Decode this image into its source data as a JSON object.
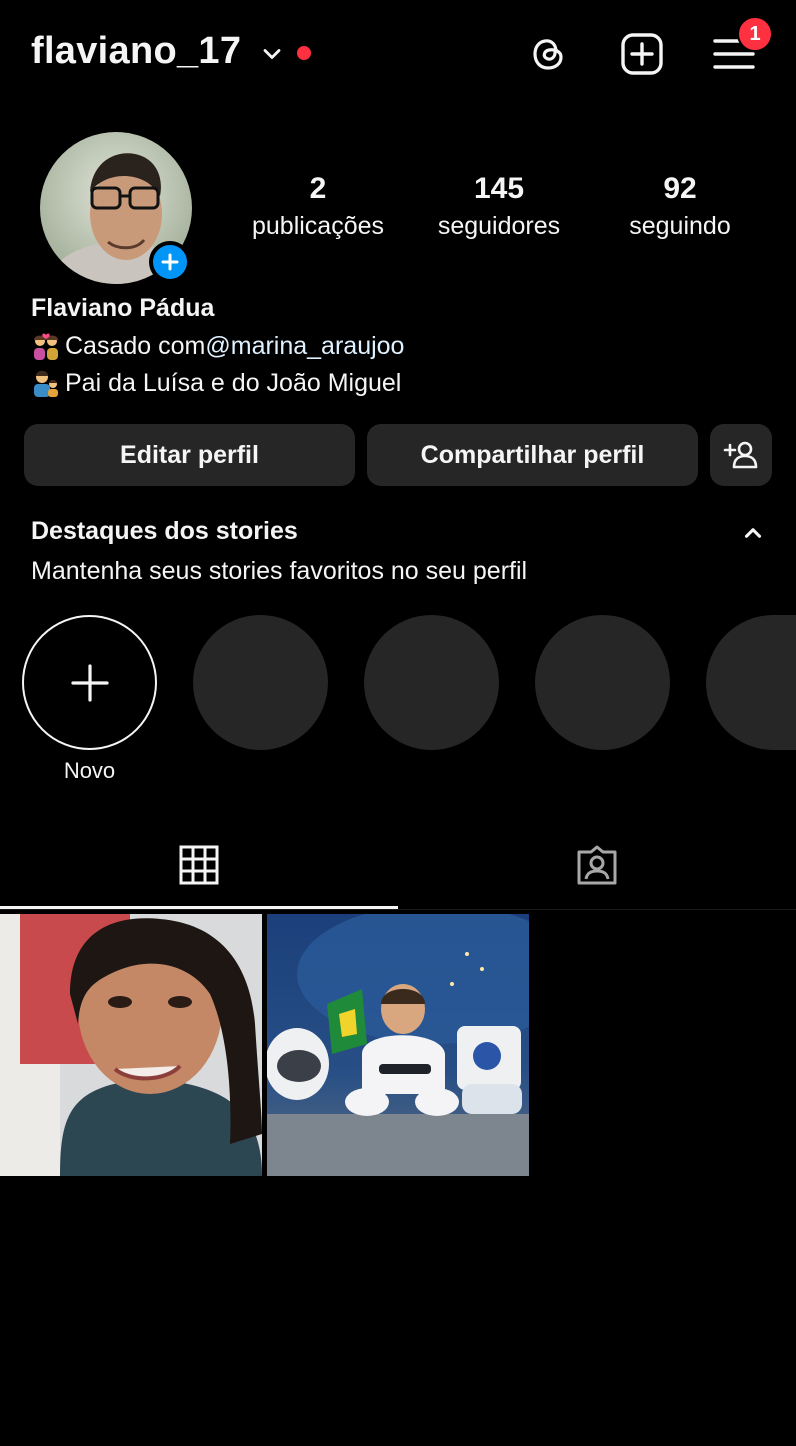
{
  "header": {
    "username": "flaviano_17",
    "notification_count": "1",
    "icons": [
      "chevron-down-icon",
      "threads-icon",
      "new-post-icon",
      "menu-icon"
    ],
    "live_dot_color": "#ff3040"
  },
  "profile": {
    "stats": {
      "posts": {
        "value": "2",
        "label": "publicações"
      },
      "followers": {
        "value": "145",
        "label": "seguidores"
      },
      "following": {
        "value": "92",
        "label": "seguindo"
      }
    },
    "full_name": "Flaviano Pádua",
    "bio": {
      "line1_emoji": "couple-with-heart-icon",
      "line1_text": "Casado com ",
      "line1_mention": "@marina_araujoo",
      "line2_emoji": "family-man-boy-icon",
      "line2_text": "Pai da Luísa e do João Miguel"
    }
  },
  "buttons": {
    "edit_profile": "Editar perfil",
    "share_profile": "Compartilhar perfil",
    "discover_people_icon": "add-person-icon"
  },
  "highlights": {
    "title": "Destaques dos stories",
    "subtitle": "Mantenha seus stories favoritos no seu perfil",
    "new_label": "Novo"
  },
  "tabs": {
    "items": [
      "grid-icon",
      "tagged-icon"
    ],
    "active": "grid-icon"
  },
  "posts": [
    {
      "type": "photo",
      "subject": "woman-portrait"
    },
    {
      "type": "photo",
      "subject": "baby-astronaut"
    }
  ],
  "colors": {
    "background": "#000000",
    "surface": "#262626",
    "accent": "#0095f6",
    "badge": "#ff3040"
  }
}
